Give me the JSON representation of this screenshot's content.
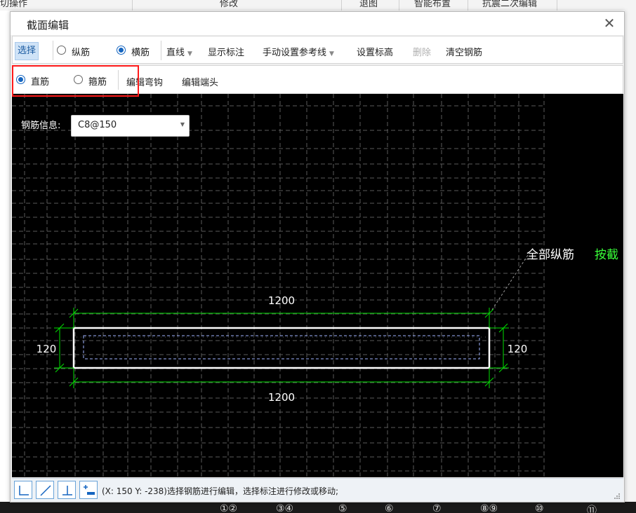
{
  "background": {
    "top_items": [
      "切操作",
      "修改",
      "退图",
      "智能布置",
      "抗震二次编辑"
    ],
    "bottom_items": [
      "①②",
      "③④",
      "⑤",
      "⑥",
      "⑦",
      "⑧⑨",
      "⑩",
      "⑪"
    ]
  },
  "dialog": {
    "title": "截面编辑",
    "close_icon": "close-icon"
  },
  "toolbar": {
    "select_label": "选择",
    "longitudinal_label": "纵筋",
    "transverse_label": "横筋",
    "line_type_label": "直线",
    "show_dim_label": "显示标注",
    "manual_ref_label": "手动设置参考线",
    "set_elev_label": "设置标高",
    "delete_label": "删除",
    "clear_label": "清空钢筋",
    "selected_mode": "横筋"
  },
  "toolbar2": {
    "straight_label": "直筋",
    "stirrup_label": "箍筋",
    "edit_hook_label": "编辑弯钩",
    "edit_end_label": "编辑端头",
    "selected": "直筋"
  },
  "rebar_info": {
    "label": "钢筋信息:",
    "value": "C8@150"
  },
  "drawing": {
    "dim_top": "1200",
    "dim_bottom": "1200",
    "dim_left": "120",
    "dim_right": "120",
    "leader_label": "全部纵筋",
    "leader_label2": "按截",
    "colors": {
      "canvas": "#000000",
      "grid": "#5a5a5a",
      "dimension": "#00e000",
      "section": "#ffffff",
      "rebar_line": "#a0b4ff",
      "label_green": "#39ff39"
    }
  },
  "status": {
    "text": "(X: 150 Y: -238)选择钢筋进行编辑，选择标注进行修改或移动;",
    "icons": [
      "orthogonal-icon",
      "diagonal-line-icon",
      "perpendicular-icon",
      "add-point-icon"
    ]
  }
}
